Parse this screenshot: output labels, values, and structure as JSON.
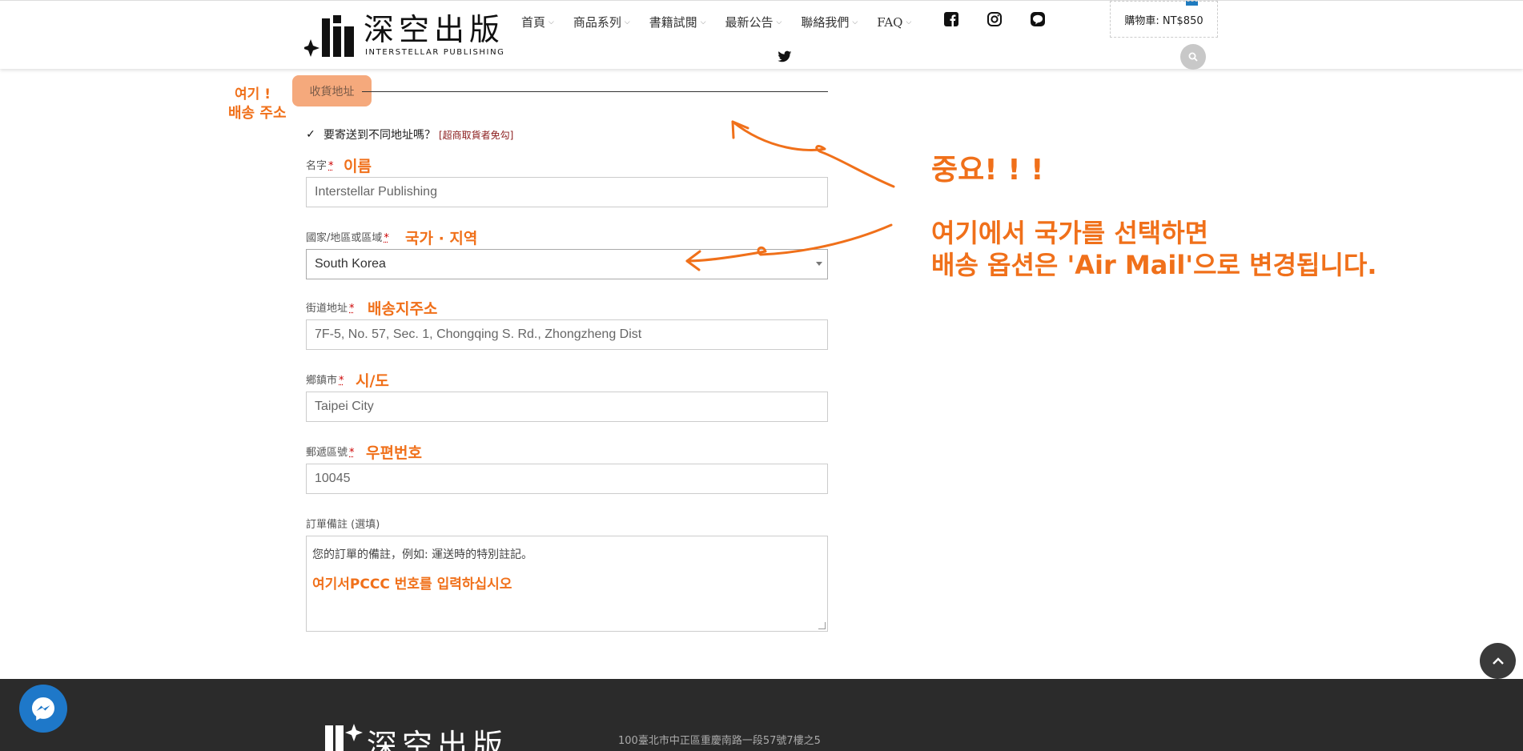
{
  "header": {
    "logo_cn": "深空出版",
    "logo_en": "INTERSTELLAR PUBLISHING",
    "nav": [
      {
        "label": "首頁"
      },
      {
        "label": "商品系列"
      },
      {
        "label": "書籍試閱"
      },
      {
        "label": "最新公告"
      },
      {
        "label": "聯絡我們"
      },
      {
        "label": "FAQ"
      }
    ],
    "social_icons": [
      "facebook-icon",
      "instagram-icon",
      "line-icon",
      "twitter-icon"
    ],
    "cart_label": "購物車: NT$850"
  },
  "form": {
    "section_title": "收貨地址",
    "ship_different_label": "要寄送到不同地址嗎？",
    "ship_different_checked": true,
    "ship_different_link": "[超商取貨者免勾]",
    "fields": {
      "name": {
        "label": "名字",
        "value": "Interstellar Publishing"
      },
      "country": {
        "label": "國家/地區或區域",
        "value": "South Korea"
      },
      "street": {
        "label": "街道地址",
        "value": "7F-5, No. 57, Sec. 1, Chongqing S. Rd., Zhongzheng Dist"
      },
      "city": {
        "label": "鄉鎮市",
        "value": "Taipei City"
      },
      "postcode": {
        "label": "郵遞區號",
        "value": "10045"
      },
      "notes": {
        "label": "訂單備註 (選填)",
        "placeholder": "您的訂單的備註，例如: 運送時的特別註記。"
      }
    },
    "required_mark": "*"
  },
  "annotations": {
    "here_line1": "여기 !",
    "here_line2": "배송 주소",
    "name": "이름",
    "country": "국가 · 지역",
    "street": "배송지주소",
    "city": "시/도",
    "postcode": "우편번호",
    "notes": "여기서PCCC 번호를 입력하십시오",
    "important": "중요! ! !",
    "explain_line1": "여기에서 국가를 선택하면",
    "explain_line2": "배송 옵션은 'Air Mail'으로 변경됩니다.",
    "accent_color": "#f0701a"
  },
  "footer": {
    "logo_cn": "深空出版",
    "address": "100臺北市中正區重慶南路一段57號7樓之5"
  }
}
